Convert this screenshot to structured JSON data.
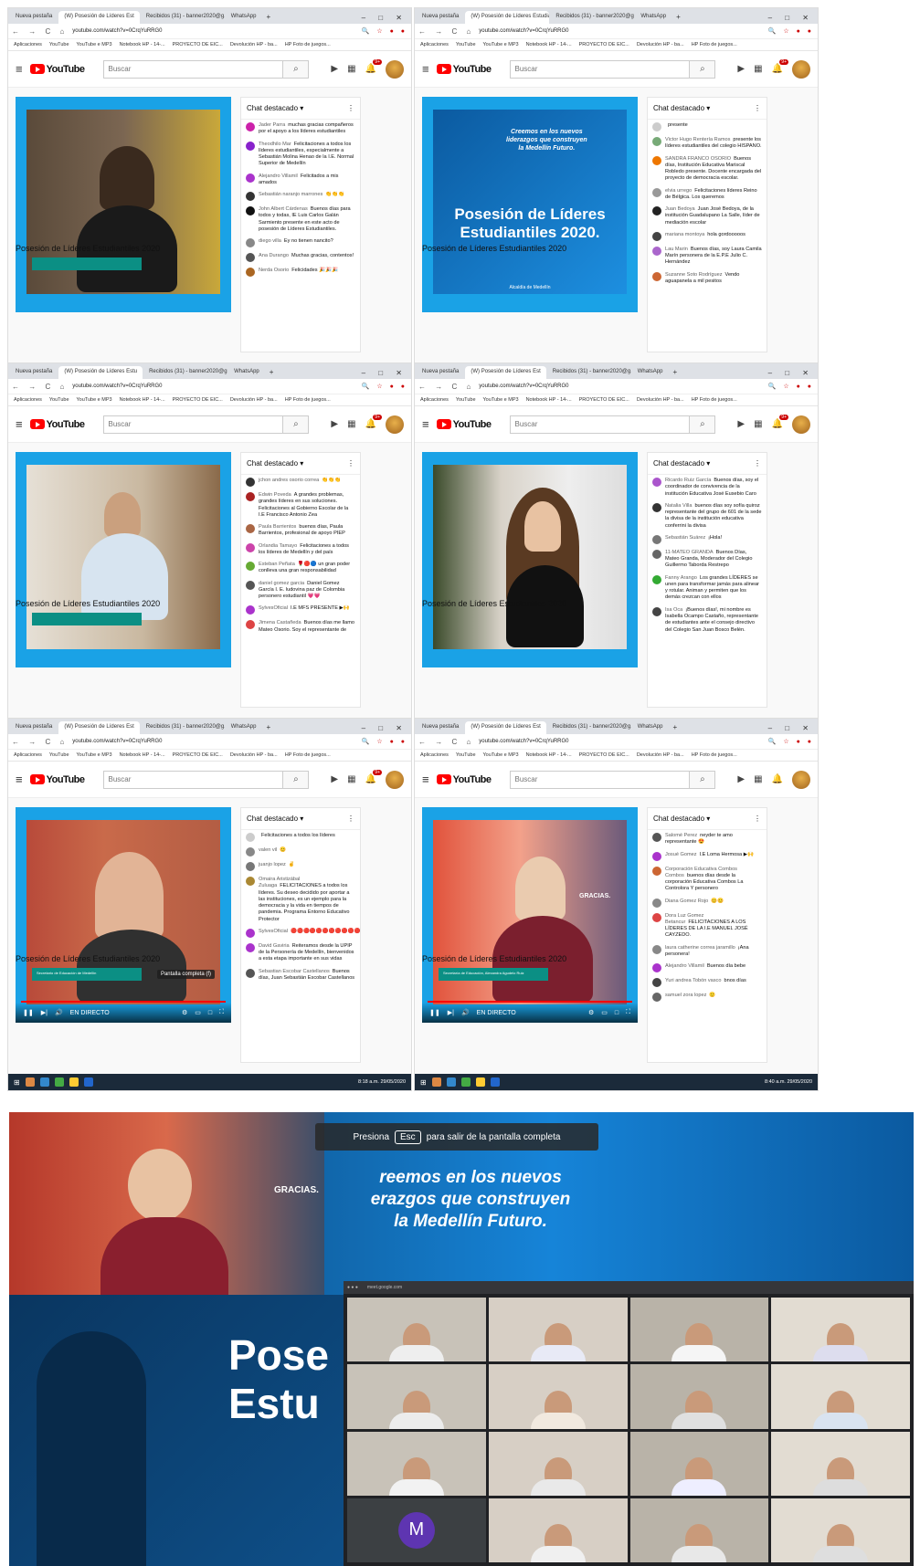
{
  "common": {
    "search_placeholder": "Buscar",
    "logo_text": "YouTube",
    "chat_title": "Chat destacado ▾",
    "video_title": "Posesión de Líderes Estudiantiles 2020",
    "url": "youtube.com/watch?v=0CrqYuRRG0",
    "bookmarks": [
      "Aplicaciones",
      "YouTube",
      "YouTube e MP3",
      "Notebook HP - 14-...",
      "PROYECTO DE EIC...",
      "Devolución HP - ba...",
      "HP Foto de juegos..."
    ],
    "tabs": [
      "Nueva pestaña",
      "(W) Posesión de Líderes Estudiantiles",
      "Recibidos (31) - banner2020@g...",
      "WhatsApp"
    ],
    "win_controls": "– □ ✕"
  },
  "panels": [
    {
      "tab_active": "(W) Posesión de Líderes Est",
      "clock": "8:16 a.m. 29/05/2020",
      "bell": "9+",
      "messages": [
        {
          "a": "Jader Parra",
          "t": "muchas gracias compañeros por el apoyo a los líderes estudiantiles",
          "c": "#c2a"
        },
        {
          "a": "Theodhilo Mar",
          "t": "Felicitaciones a todos los líderes estudiantiles, especialmente a Sebastián Molina Henao de la I.E. Normal Superior de Medellín",
          "c": "#82c"
        },
        {
          "a": "Alejandro Villamil",
          "t": "Felicitados a mis amados",
          "c": "#a3c"
        },
        {
          "a": "Sebastián naranjo marrones",
          "t": "👏👏👏",
          "c": "#333"
        },
        {
          "a": "John Albert Cárdenas",
          "t": "Buenos días para todos y todas, IE Luis Carlos Galán Sarmiento presente en este acto de posesión de Líderes Estudiantiles.",
          "c": "#111"
        },
        {
          "a": "diego villa",
          "t": "Ey no tienen nancito?",
          "c": "#888"
        },
        {
          "a": "Ana Durango",
          "t": "Muchas gracias, contentos!",
          "c": "#555"
        },
        {
          "a": "Nerda Osorio",
          "t": "Felicidades 🎉🎉🎉",
          "c": "#a62"
        }
      ]
    },
    {
      "tab_active": "(W) Posesión de Líderes Estudia",
      "clock": "8:13 a.m. 29/05/2020",
      "bell": "9+",
      "video_lines": [
        "Creemos en los nuevos",
        "liderazgos que construyen",
        "la Medellín Futuro.",
        "Posesión de Líderes",
        "Estudiantiles 2020.",
        "Alcaldía de Medellín"
      ],
      "messages": [
        {
          "a": "",
          "t": "presente",
          "c": "#ccc"
        },
        {
          "a": "Victor Hugo Rentería Ramos",
          "t": "presente los líderes estudiantiles del colegio HISPANO.",
          "c": "#7a7"
        },
        {
          "a": "SANDRA FRANCO OSORIO",
          "t": "Buenos días, Institución Educativa Mariscal Robledo presente. Docente encargada del proyecto de democracia escolar.",
          "c": "#e70"
        },
        {
          "a": "elvia urrego",
          "t": "Felicitaciones líderes Reino de Bélgica. Los queremos",
          "c": "#999"
        },
        {
          "a": "Juan Bedoya",
          "t": "Juan José Bedoya, de la institución Guadalupano La Salle, líder de mediación escolar",
          "c": "#222"
        },
        {
          "a": "mariana montoya",
          "t": "hola gordooooos",
          "c": "#444"
        },
        {
          "a": "Lau Marin",
          "t": "Buenos días, soy Laura Camila Marín personera de la E.P.E Julio C. Hernández",
          "c": "#a6c"
        },
        {
          "a": "Suzanne Soto Rodríguez",
          "t": "Vendo aguapanela a mil pesitos",
          "c": "#c63"
        }
      ]
    },
    {
      "tab_active": "(W) Posesión de Líderes Estu",
      "clock": "8:17 a.m. 29/05/2020",
      "bell": "9+",
      "messages": [
        {
          "a": "jchon andres osorio correa",
          "t": "👏👏👏",
          "c": "#333"
        },
        {
          "a": "Edwin Poveda",
          "t": "A grandes problemas, grandes líderes en sus soluciones. Felicitaciones al Gobierno Escolar de la I.E Francisco Antonio Zea",
          "c": "#a22"
        },
        {
          "a": "Paula Barrientos",
          "t": "buenos días, Paula Barrientos, profesional de apoyo PIEP",
          "c": "#a64"
        },
        {
          "a": "Orlandia Tamayo",
          "t": "Felicitaciones a todos los líderes de Medellín y del país",
          "c": "#c4a"
        },
        {
          "a": "Esteban Peñata",
          "t": "🌹🔴🔵 un gran poder conlleva una gran responsabilidad",
          "c": "#6a3"
        },
        {
          "a": "daniel gomez garcia",
          "t": "Daniel Gomez García I. E. ludovina paz de Colombia personero estudiantil 💗💗",
          "c": "#555"
        },
        {
          "a": "SylvesOficial",
          "t": "I.E MFS PRESENTE ▶🙌",
          "c": "#a3c"
        },
        {
          "a": "Jimena Castañeda",
          "t": "Buenos días me llamo Mateo Osorio. Soy el representante de",
          "c": "#d44"
        }
      ]
    },
    {
      "tab_active": "(W) Posesión de Líderes Est",
      "clock": "8:17 a.m. 29/05/2020",
      "bell": "9+",
      "messages": [
        {
          "a": "Ricardo Ruiz García",
          "t": "Buenos días, soy el coordinador de convivencia de la institución Educativa José Eusebio Caro",
          "c": "#a5c"
        },
        {
          "a": "Natalia Villa",
          "t": "buenos días soy sofía quiroz representante del grupo de 601 de la sede la divisa de la institución educativa conferrini la divisa",
          "c": "#333"
        },
        {
          "a": "Sebastián Suárez",
          "t": "¡Hola!",
          "c": "#777"
        },
        {
          "a": "11-MATEO GRANDA",
          "t": "Buenos Días, Mateo Granda, Moderador del Colegio Guillermo Taborda Restrepo",
          "c": "#666"
        },
        {
          "a": "Fanny Arango",
          "t": "Los grandes LÍDERES se unen para transformar jamás para alinear y rotular. Animan y permiten que los demás crezcan con ellos",
          "c": "#3a3"
        },
        {
          "a": "Isa Oca",
          "t": "¡Buenos días!, mi nombre es Isabella Ocampo Castaño, representante de estudiantes ante el consejo directivo del Colegio San Juan Bosco Belén.",
          "c": "#444"
        }
      ]
    },
    {
      "tab_active": "(W) Posesión de Líderes Est",
      "clock": "8:18 a.m. 29/05/2020",
      "bell": "9+",
      "live": "EN DIRECTO",
      "tooltip": "Pantalla completa (f)",
      "lower": "Secretario de Educación de Medellín",
      "messages": [
        {
          "a": "",
          "t": "Felicitaciones a todos los líderes",
          "c": "#ccc"
        },
        {
          "a": "valen vil",
          "t": "😊",
          "c": "#888"
        },
        {
          "a": "juanjo lopez",
          "t": "✌",
          "c": "#777"
        },
        {
          "a": "Omaira Aristizábal Zuluaga",
          "t": "FELICITACIONES a todos los líderes. Su deseo decidido por aportar a las instituciones, es un ejemplo para la democracia y la vida en tiempos de pandemia. Programa Entorno Educativo Protector",
          "c": "#a83"
        },
        {
          "a": "SylvesOficial",
          "t": "🔴🔴🔴🔴🔴🔴🔴🔴🔴🔴🔴🔴🔴🔴🔴",
          "c": "#a3c"
        },
        {
          "a": "David Gaviria",
          "t": "Reiteramos desde la UPIP de la Personería de Medellín, bienvenidos a esta etapa importante en sus vidas",
          "c": "#a3c"
        },
        {
          "a": "Sebastian Escobar Castellanos",
          "t": "Buenos días, Juan Sebastián Escobar Castellanos",
          "c": "#555"
        }
      ]
    },
    {
      "tab_active": "(W) Posesión de Líderes Est",
      "clock": "8:40 a.m. 29/05/2020",
      "bell": "",
      "live": "EN DIRECTO",
      "video_word": "GRACIAS.",
      "lower": "Secretaría de Educación, Alexandra Agudelo Ruiz",
      "messages": [
        {
          "a": "Salomé Perez",
          "t": "neyder te amo representante 😍",
          "c": "#555"
        },
        {
          "a": "Josué Gomez",
          "t": "I.E Loma Hermosa ▶🙌",
          "c": "#a3c"
        },
        {
          "a": "Corporación Educativa Combos Combos",
          "t": "buenos días desde la corporación Educativa Combos La Controlora Y personero",
          "c": "#c63"
        },
        {
          "a": "Diana Gomez Rojo",
          "t": "😊😊",
          "c": "#888"
        },
        {
          "a": "Dora Luz Gomez Betancur",
          "t": "FELICITACIONES A LOS LÍDERES DE LA I.E MANUEL JOSÉ CAYZEDO.",
          "c": "#d44"
        },
        {
          "a": "laura catherine correa jaramillo",
          "t": "¡Ana personera!",
          "c": "#888"
        },
        {
          "a": "Alejandro Villamil",
          "t": "Buenos día bebe",
          "c": "#a3c"
        },
        {
          "a": "Yuri andrea Tobón vasco",
          "t": "bnos días",
          "c": "#444"
        },
        {
          "a": "samuel zora lopez",
          "t": "🙂",
          "c": "#666"
        }
      ]
    }
  ],
  "bottom": {
    "banner_pre": "Presiona",
    "banner_key": "Esc",
    "banner_post": "para salir de la pantalla completa",
    "tagline_lines": [
      "reemos  en los nuevos",
      "erazgos que construyen",
      "la Medellín Futuro."
    ],
    "pose_lines": [
      "Pose",
      "Estu"
    ],
    "meet_letter": "M",
    "video_word": "GRACIAS."
  }
}
